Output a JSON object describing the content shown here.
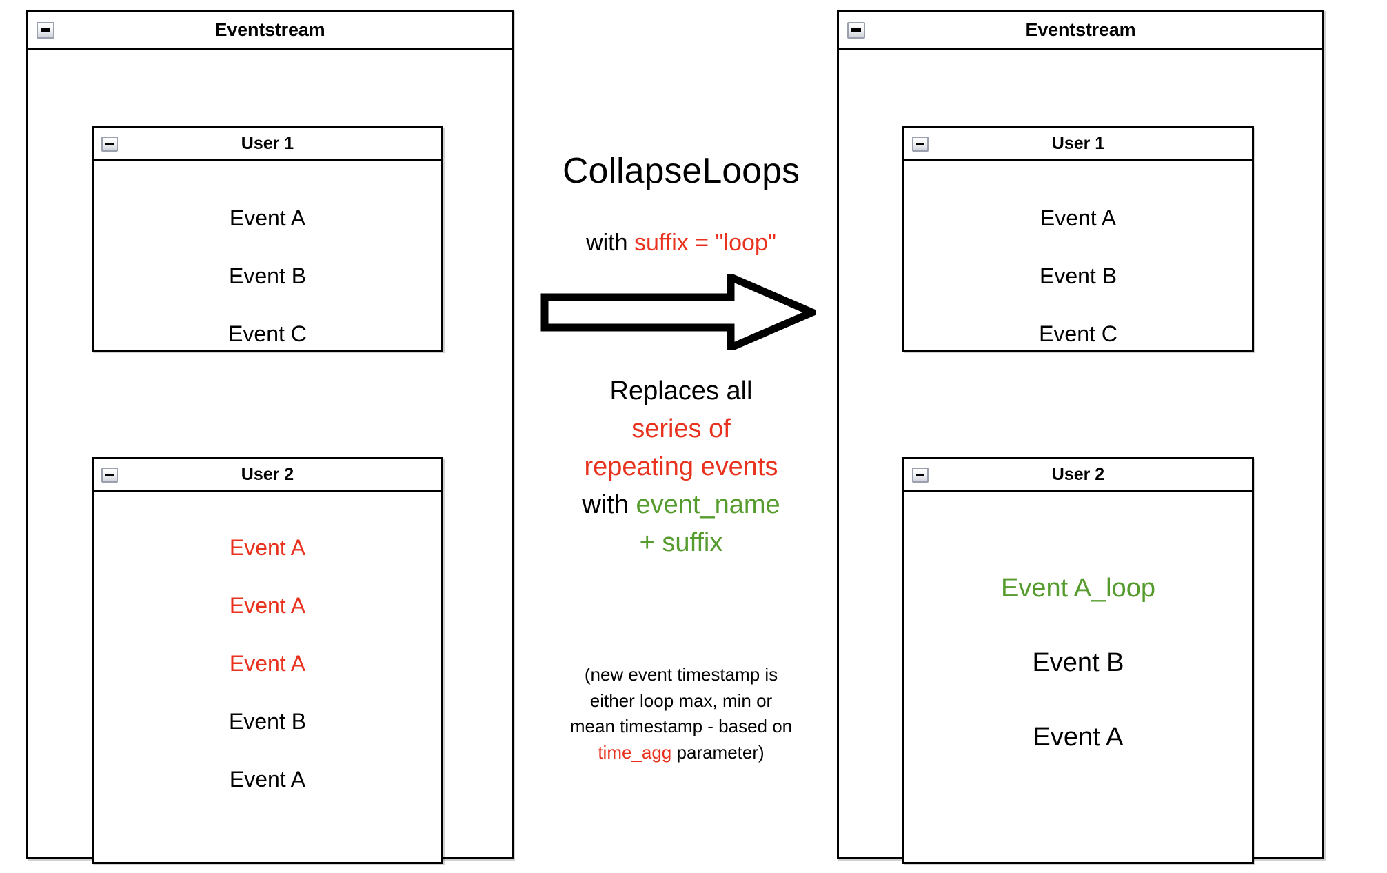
{
  "left_panel": {
    "title": "Eventstream",
    "collapse_icon": "minus-icon",
    "users": [
      {
        "title": "User 1",
        "collapse_icon": "minus-icon",
        "events": [
          {
            "label": "Event A",
            "color": "black"
          },
          {
            "label": "Event B",
            "color": "black"
          },
          {
            "label": "Event C",
            "color": "black"
          }
        ]
      },
      {
        "title": "User 2",
        "collapse_icon": "minus-icon",
        "events": [
          {
            "label": "Event A",
            "color": "red"
          },
          {
            "label": "Event A",
            "color": "red"
          },
          {
            "label": "Event A",
            "color": "red"
          },
          {
            "label": "Event B",
            "color": "black"
          },
          {
            "label": "Event A",
            "color": "black"
          }
        ]
      }
    ]
  },
  "right_panel": {
    "title": "Eventstream",
    "collapse_icon": "minus-icon",
    "users": [
      {
        "title": "User 1",
        "collapse_icon": "minus-icon",
        "events": [
          {
            "label": "Event A",
            "color": "black"
          },
          {
            "label": "Event B",
            "color": "black"
          },
          {
            "label": "Event C",
            "color": "black"
          }
        ]
      },
      {
        "title": "User 2",
        "collapse_icon": "minus-icon",
        "events": [
          {
            "label": "Event A_loop",
            "color": "green"
          },
          {
            "label": "Event B",
            "color": "black"
          },
          {
            "label": "Event A",
            "color": "black"
          }
        ]
      }
    ]
  },
  "center": {
    "operation_title": "CollapseLoops",
    "params_prefix": "with ",
    "params_value": "suffix = \"loop\"",
    "arrow_icon": "right-block-arrow-icon",
    "description": {
      "line1": "Replaces all",
      "line2": "series of",
      "line3": "repeating events",
      "line4_prefix": "with ",
      "line4_value": "event_name",
      "line5": "+ suffix"
    },
    "note": {
      "line1": "(new event timestamp is",
      "line2": "either loop max, min or",
      "line3": "mean timestamp - based on",
      "line4_value": "time_agg",
      "line4_suffix": " parameter)"
    }
  },
  "colors": {
    "red": "#e8321e",
    "green": "#559b2d",
    "black": "#000000",
    "border": "#000000",
    "background": "#ffffff"
  }
}
